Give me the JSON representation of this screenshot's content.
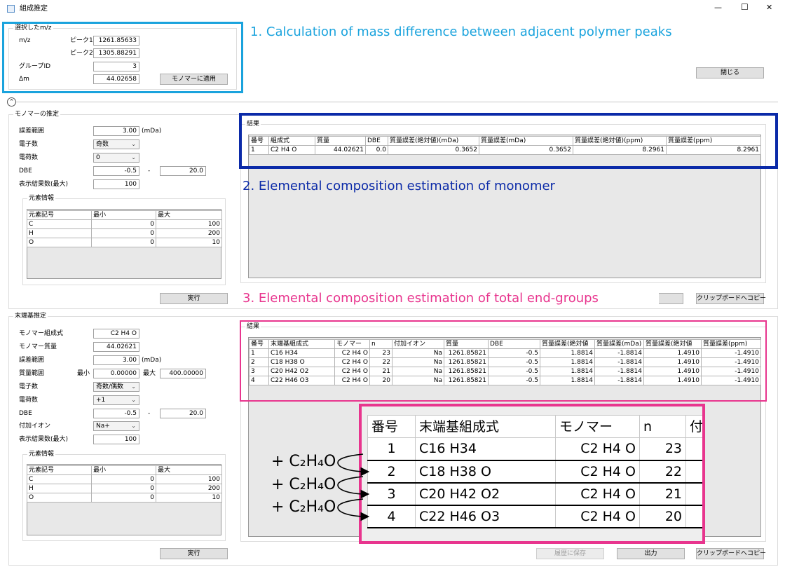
{
  "window": {
    "title": "組成推定",
    "minimize": "—",
    "maximize": "☐",
    "close": "✕"
  },
  "callouts": {
    "c1": "1. Calculation of mass difference between adjacent polymer peaks",
    "c2": "2. Elemental composition estimation of monomer",
    "c3": "3. Elemental composition estimation of total end-groups"
  },
  "selected": {
    "title": "選択したm/z",
    "mz_label": "m/z",
    "peak1_label": "ピーク1",
    "peak1": "1261.85633",
    "peak2_label": "ピーク2",
    "peak2": "1305.88291",
    "group_label": "グループID",
    "group": "3",
    "dm_label": "Δm",
    "dm": "44.02658",
    "apply_button": "モノマーに適用"
  },
  "close_button": "閉じる",
  "collapse_icon": "⌃",
  "monomer": {
    "title": "モノマーの推定",
    "tol_label": "誤差範囲",
    "tol": "3.00",
    "tol_unit": "(mDa)",
    "elec_label": "電子数",
    "elec": "奇数",
    "charge_label": "電荷数",
    "charge": "0",
    "dbe_label": "DBE",
    "dbe_min": "-0.5",
    "dbe_dash": "-",
    "dbe_max": "20.0",
    "max_label": "表示結果数(最大)",
    "max": "100",
    "elem_title": "元素情報",
    "elem_headers": [
      "元素記号",
      "最小",
      "最大"
    ],
    "elem_rows": [
      [
        "C",
        "0",
        "100"
      ],
      [
        "H",
        "0",
        "200"
      ],
      [
        "O",
        "0",
        "10"
      ]
    ],
    "run_button": "実行",
    "result_title": "結果",
    "result_headers": [
      "番号",
      "組成式",
      "質量",
      "DBE",
      "質量誤差(絶対値)(mDa)",
      "質量誤差(mDa)",
      "質量誤差(絶対値)(ppm)",
      "質量誤差(ppm)"
    ],
    "result_rows": [
      [
        "1",
        "C2 H4 O",
        "44.02621",
        "0.0",
        "0.3652",
        "0.3652",
        "8.2961",
        "8.2961"
      ]
    ],
    "copy_button": "クリップボードへコピー"
  },
  "endgroup": {
    "title": "末端基推定",
    "mono_formula_label": "モノマー組成式",
    "mono_formula": "C2 H4 O",
    "mono_mass_label": "モノマー質量",
    "mono_mass": "44.02621",
    "tol_label": "誤差範囲",
    "tol": "3.00",
    "tol_unit": "(mDa)",
    "mass_range_label": "質量範囲",
    "min_label": "最小",
    "mass_min": "0.00000",
    "max_label2": "最大",
    "mass_max": "400.00000",
    "elec_label": "電子数",
    "elec": "奇数/偶数",
    "charge_label": "電荷数",
    "charge": "+1",
    "dbe_label": "DBE",
    "dbe_min": "-0.5",
    "dbe_dash": "-",
    "dbe_max": "20.0",
    "adduct_label": "付加イオン",
    "adduct": "Na+",
    "max_label": "表示結果数(最大)",
    "max": "100",
    "elem_title": "元素情報",
    "elem_headers": [
      "元素記号",
      "最小",
      "最大"
    ],
    "elem_rows": [
      [
        "C",
        "0",
        "100"
      ],
      [
        "H",
        "0",
        "200"
      ],
      [
        "O",
        "0",
        "10"
      ]
    ],
    "run_button": "実行",
    "result_title": "結果",
    "result_headers": [
      "番号",
      "末端基組成式",
      "モノマー",
      "n",
      "付加イオン",
      "質量",
      "DBE",
      "質量誤差(絶対値",
      "質量誤差(mDa)",
      "質量誤差(絶対値",
      "質量誤差(ppm)"
    ],
    "result_rows": [
      [
        "1",
        "C16 H34",
        "C2 H4 O",
        "23",
        "Na",
        "1261.85821",
        "-0.5",
        "1.8814",
        "-1.8814",
        "1.4910",
        "-1.4910"
      ],
      [
        "2",
        "C18 H38 O",
        "C2 H4 O",
        "22",
        "Na",
        "1261.85821",
        "-0.5",
        "1.8814",
        "-1.8814",
        "1.4910",
        "-1.4910"
      ],
      [
        "3",
        "C20 H42 O2",
        "C2 H4 O",
        "21",
        "Na",
        "1261.85821",
        "-0.5",
        "1.8814",
        "-1.8814",
        "1.4910",
        "-1.4910"
      ],
      [
        "4",
        "C22 H46 O3",
        "C2 H4 O",
        "20",
        "Na",
        "1261.85821",
        "-0.5",
        "1.8814",
        "-1.8814",
        "1.4910",
        "-1.4910"
      ]
    ],
    "save_button": "履歴に保存",
    "output_button": "出力",
    "copy_button": "クリップボードへコピー"
  },
  "zoom": {
    "headers": [
      "番号",
      "末端基組成式",
      "モノマー",
      "n",
      "付"
    ],
    "rows": [
      [
        "1",
        "C16 H34",
        "C2 H4 O",
        "23"
      ],
      [
        "2",
        "C18 H38 O",
        "C2 H4 O",
        "22"
      ],
      [
        "3",
        "C20 H42 O2",
        "C2 H4 O",
        "21"
      ],
      [
        "4",
        "C22 H46 O3",
        "C2 H4 O",
        "20"
      ]
    ],
    "plus_label": "+ C₂H₄O"
  },
  "colors": {
    "callout1": "#1aa3dd",
    "callout2": "#0b2aa8",
    "callout3": "#e8358e",
    "box1": "#1aa3dd",
    "box2": "#0b2aa8",
    "box3": "#e8358e"
  }
}
